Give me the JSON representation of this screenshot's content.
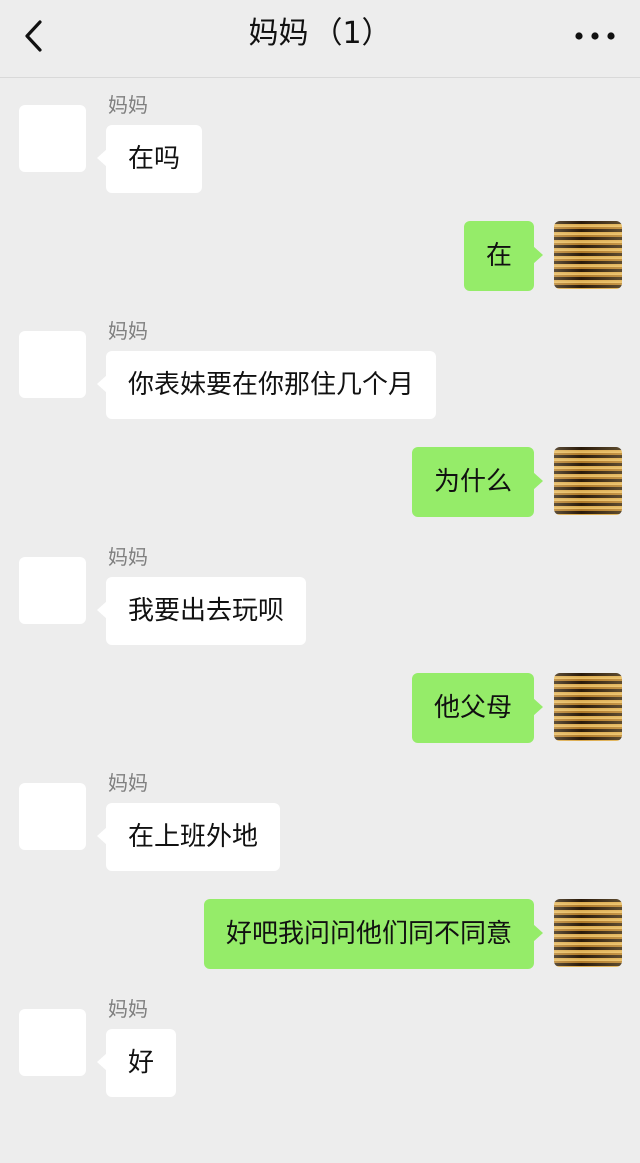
{
  "header": {
    "title": "妈妈",
    "count": "（1）",
    "back_icon": "chevron-left-icon",
    "more_icon": "more-dots-icon"
  },
  "messages": [
    {
      "side": "in",
      "sender": "妈妈",
      "text": "在吗"
    },
    {
      "side": "out",
      "text": "在"
    },
    {
      "side": "in",
      "sender": "妈妈",
      "text": "你表妹要在你那住几个月"
    },
    {
      "side": "out",
      "text": "为什么"
    },
    {
      "side": "in",
      "sender": "妈妈",
      "text": "我要出去玩呗"
    },
    {
      "side": "out",
      "text": "他父母"
    },
    {
      "side": "in",
      "sender": "妈妈",
      "text": "在上班外地"
    },
    {
      "side": "out",
      "text": "好吧我问问他们同不同意"
    },
    {
      "side": "in",
      "sender": "妈妈",
      "text": "好"
    }
  ],
  "colors": {
    "background": "#ededed",
    "incoming_bubble": "#ffffff",
    "outgoing_bubble": "#95ec69"
  }
}
